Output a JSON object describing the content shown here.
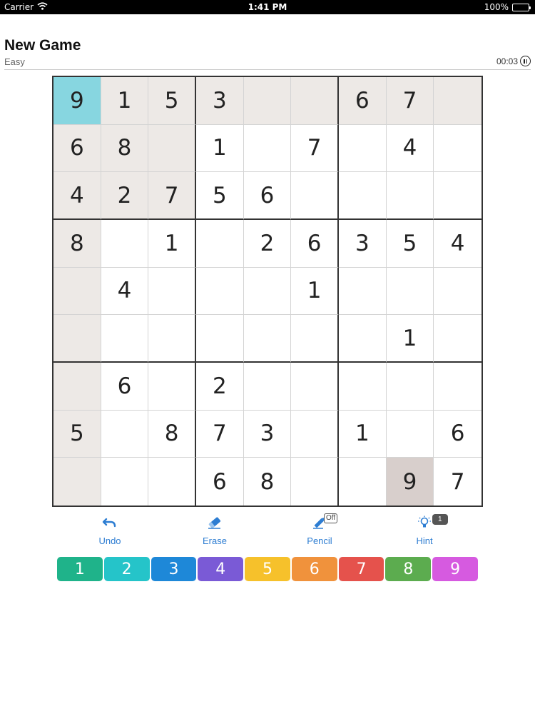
{
  "status_bar": {
    "carrier": "Carrier",
    "time": "1:41 PM",
    "battery": "100%"
  },
  "header": {
    "title": "New Game",
    "difficulty": "Easy",
    "timer": "00:03",
    "pause_icon": "pause-circle-icon"
  },
  "board": {
    "grid": [
      [
        9,
        1,
        5,
        3,
        null,
        null,
        6,
        7,
        null
      ],
      [
        6,
        8,
        null,
        1,
        null,
        7,
        null,
        4,
        null
      ],
      [
        4,
        2,
        7,
        5,
        6,
        null,
        null,
        null,
        null
      ],
      [
        8,
        null,
        1,
        null,
        2,
        6,
        3,
        5,
        4
      ],
      [
        null,
        4,
        null,
        null,
        null,
        1,
        null,
        null,
        null
      ],
      [
        null,
        null,
        null,
        null,
        null,
        null,
        null,
        1,
        null
      ],
      [
        null,
        6,
        null,
        2,
        null,
        null,
        null,
        null,
        null
      ],
      [
        5,
        null,
        8,
        7,
        3,
        null,
        1,
        null,
        6
      ],
      [
        null,
        null,
        null,
        6,
        8,
        null,
        null,
        9,
        7
      ]
    ],
    "selected_cell": {
      "row": 0,
      "col": 0
    },
    "same_value_cells": [
      {
        "row": 8,
        "col": 7
      }
    ],
    "colors": {
      "selected": "#87d6e0",
      "related": "#ede9e6",
      "same_value": "#d8cfcc"
    }
  },
  "tools": {
    "undo": {
      "label": "Undo",
      "icon": "undo-arrow-icon"
    },
    "erase": {
      "label": "Erase",
      "icon": "eraser-icon"
    },
    "pencil": {
      "label": "Pencil",
      "icon": "pencil-icon",
      "state": "Off"
    },
    "hint": {
      "label": "Hint",
      "icon": "lightbulb-icon",
      "count": "1"
    },
    "accent_color": "#2d7dd2"
  },
  "number_pad": [
    {
      "label": "1",
      "color": "#1fb38a"
    },
    {
      "label": "2",
      "color": "#25c4c9"
    },
    {
      "label": "3",
      "color": "#1e88d8"
    },
    {
      "label": "4",
      "color": "#7a5ad6"
    },
    {
      "label": "5",
      "color": "#f6c12b"
    },
    {
      "label": "6",
      "color": "#f0923c"
    },
    {
      "label": "7",
      "color": "#e5524c"
    },
    {
      "label": "8",
      "color": "#5cac4f"
    },
    {
      "label": "9",
      "color": "#d65ae0"
    }
  ]
}
